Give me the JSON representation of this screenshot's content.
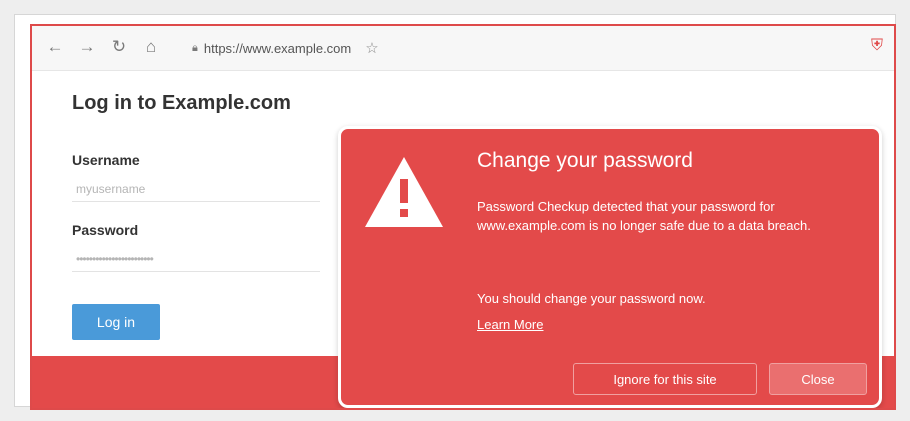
{
  "browser": {
    "url": "https://www.example.com",
    "nav_icons": [
      "back-arrow-icon",
      "forward-arrow-icon",
      "reload-icon",
      "home-icon"
    ],
    "lock_icon": "lock-icon",
    "star_icon": "star-icon",
    "extension_icon": "password-checkup-icon"
  },
  "login": {
    "title": "Log in to Example.com",
    "username_label": "Username",
    "username_value": "myusername",
    "password_label": "Password",
    "password_value": "••••••••••••••••••••••••",
    "button_label": "Log in"
  },
  "dialog": {
    "title": "Change your password",
    "message": "Password Checkup detected that your password for www.example.com is no longer safe due to a data breach.",
    "advice": "You should change your password now.",
    "link": "Learn More",
    "ignore_label": "Ignore for this site",
    "close_label": "Close",
    "icon": "warning-icon"
  },
  "colors": {
    "accent_red": "#e34a4a",
    "button_blue": "#4a9ad9"
  }
}
